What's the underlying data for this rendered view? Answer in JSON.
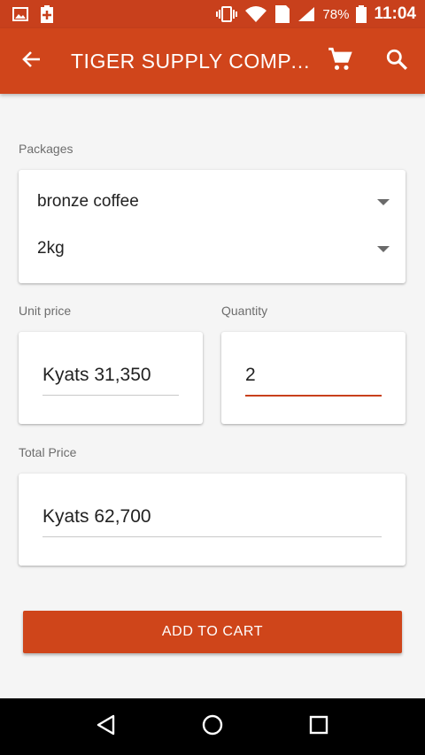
{
  "status_bar": {
    "battery": "78%",
    "time": "11:04",
    "sim_badge": "1",
    "icons": [
      "image-icon",
      "battery-plus-icon",
      "vibrate-icon",
      "wifi-icon",
      "sim-icon",
      "signal-icon",
      "battery-icon"
    ]
  },
  "app_bar": {
    "title": "TIGER SUPPLY COMPANY",
    "back_icon": "arrow-left-icon",
    "cart_icon": "cart-icon",
    "search_icon": "search-icon"
  },
  "packages": {
    "label": "Packages",
    "product": "bronze coffee",
    "size": "2kg"
  },
  "unit_price": {
    "label": "Unit price",
    "value": "Kyats 31,350"
  },
  "quantity": {
    "label": "Quantity",
    "value": "2"
  },
  "total_price": {
    "label": "Total Price",
    "value": "Kyats 62,700"
  },
  "actions": {
    "add_to_cart": "ADD TO CART"
  },
  "colors": {
    "primary": "#d0451b",
    "status_bar": "#c8401c",
    "accent_underline": "#c8401c"
  }
}
